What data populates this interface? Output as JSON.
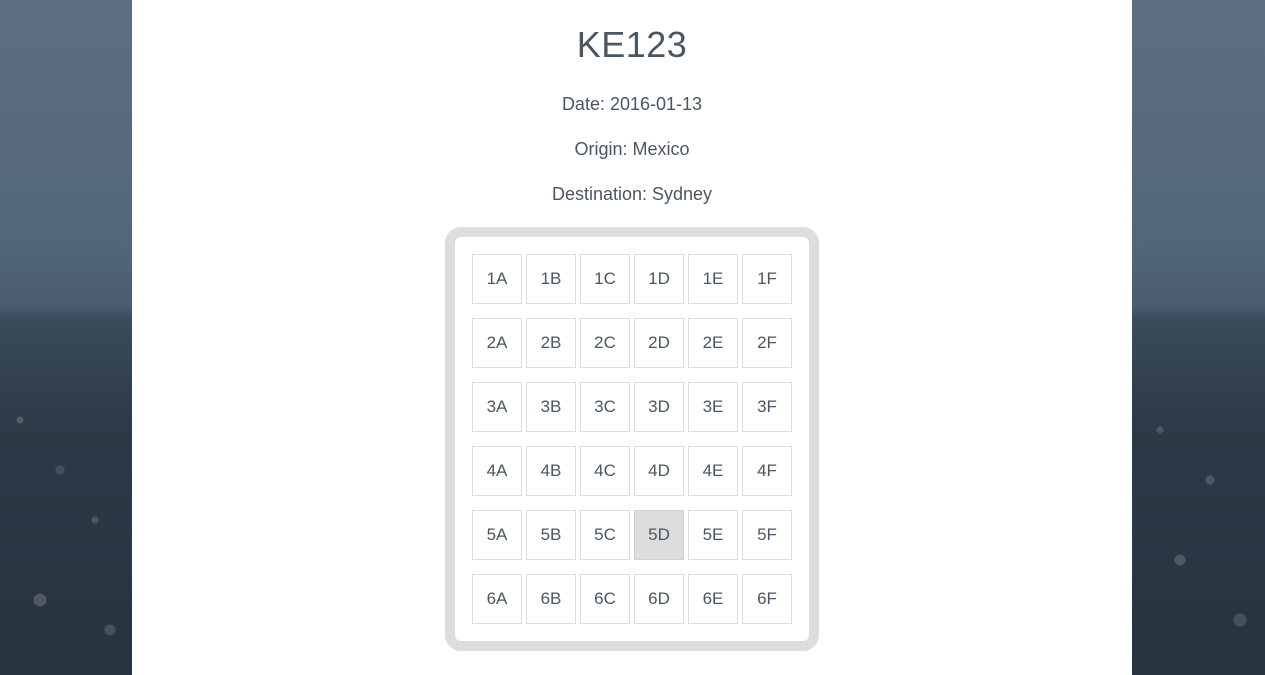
{
  "flight": {
    "number": "KE123",
    "date": "Date: 2016-01-13",
    "origin": "Origin: Mexico",
    "destination": "Destination: Sydney"
  },
  "seatmap": {
    "rows": [
      [
        "1A",
        "1B",
        "1C",
        "1D",
        "1E",
        "1F"
      ],
      [
        "2A",
        "2B",
        "2C",
        "2D",
        "2E",
        "2F"
      ],
      [
        "3A",
        "3B",
        "3C",
        "3D",
        "3E",
        "3F"
      ],
      [
        "4A",
        "4B",
        "4C",
        "4D",
        "4E",
        "4F"
      ],
      [
        "5A",
        "5B",
        "5C",
        "5D",
        "5E",
        "5F"
      ],
      [
        "6A",
        "6B",
        "6C",
        "6D",
        "6E",
        "6F"
      ]
    ],
    "selected": "5D",
    "selected_color": "#dddddd"
  }
}
